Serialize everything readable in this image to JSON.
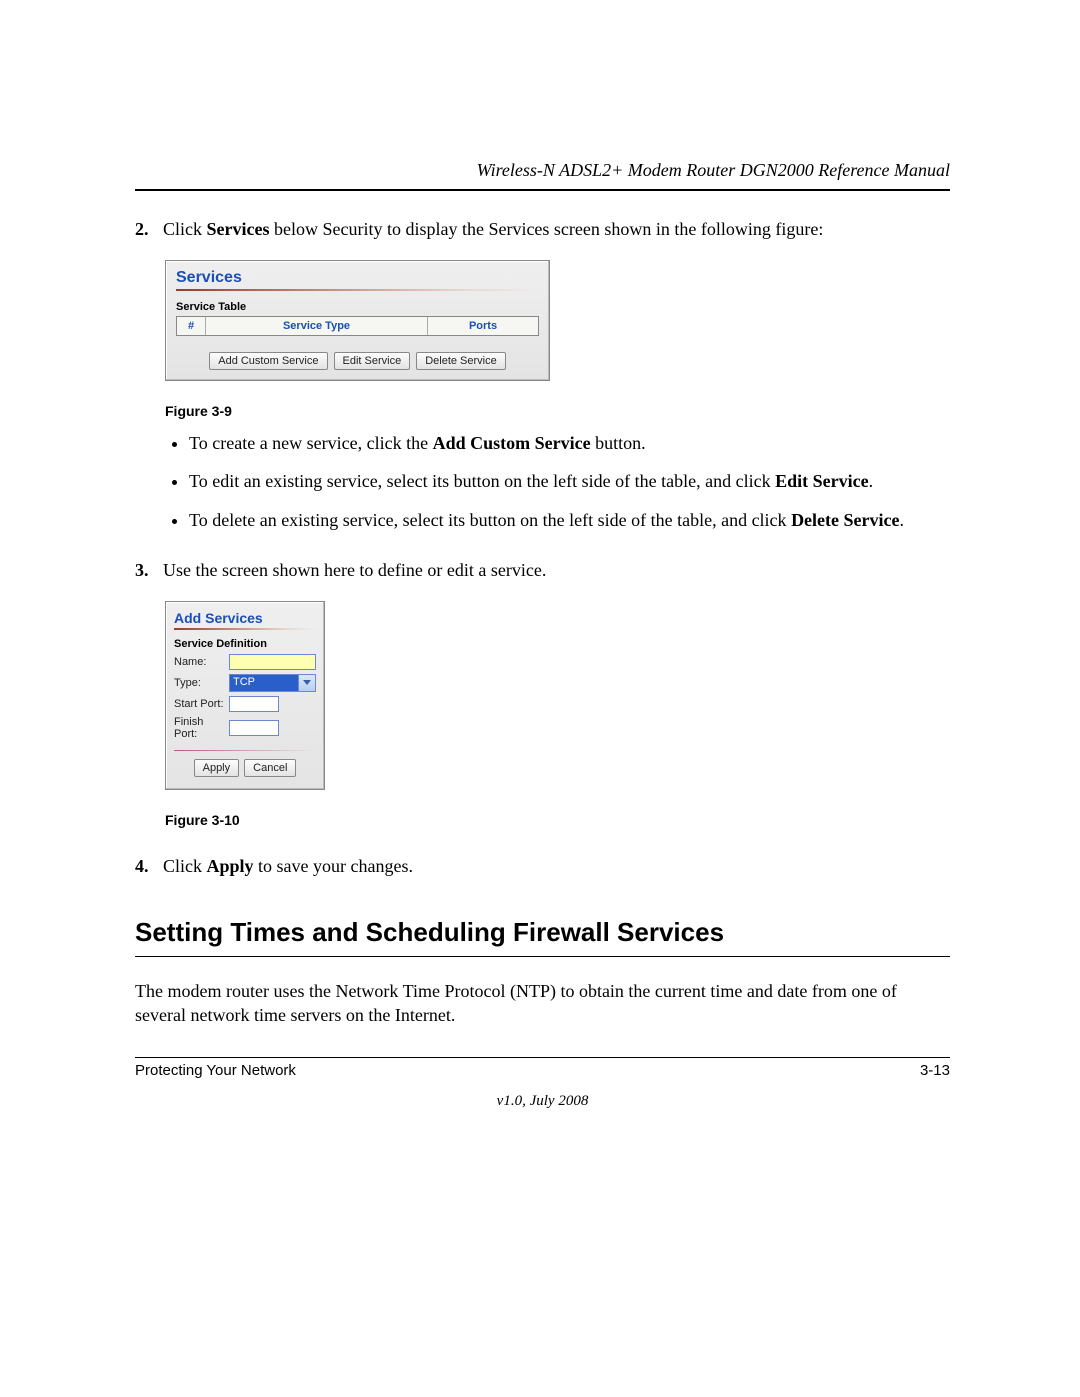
{
  "header": {
    "manual_title": "Wireless-N ADSL2+ Modem Router DGN2000 Reference Manual"
  },
  "steps": {
    "s2_num": "2.",
    "s2_a": "Click ",
    "s2_b": "Services",
    "s2_c": " below Security to display the Services screen shown in the following figure:",
    "s3_num": "3.",
    "s3_text": "Use the screen shown here to define or edit a service.",
    "s4_num": "4.",
    "s4_a": "Click ",
    "s4_b": "Apply",
    "s4_c": " to save your changes."
  },
  "fig9": {
    "title": "Services",
    "subtitle": "Service Table",
    "cols": {
      "hash": "#",
      "type": "Service Type",
      "ports": "Ports"
    },
    "buttons": {
      "add": "Add Custom Service",
      "edit": "Edit Service",
      "del": "Delete Service"
    },
    "caption": "Figure 3-9"
  },
  "bullets": {
    "b1_a": "To create a new service, click the ",
    "b1_b": "Add Custom Service",
    "b1_c": " button.",
    "b2_a": "To edit an existing service, select its button on the left side of the table, and click ",
    "b2_b": "Edit Service",
    "b2_c": ".",
    "b3_a": "To delete an existing service, select its button on the left side of the table, and click ",
    "b3_b": "Delete Service",
    "b3_c": "."
  },
  "fig10": {
    "title": "Add Services",
    "subtitle": "Service Definition",
    "labels": {
      "name": "Name:",
      "type": "Type:",
      "start": "Start Port:",
      "finish": "Finish Port:"
    },
    "type_value": "TCP",
    "buttons": {
      "apply": "Apply",
      "cancel": "Cancel"
    },
    "caption": "Figure 3-10"
  },
  "section_heading": "Setting Times and Scheduling Firewall Services",
  "body_para": "The modem router uses the Network Time Protocol (NTP) to obtain the current time and date from one of several network time servers on the Internet.",
  "footer": {
    "chapter": "Protecting Your Network",
    "page": "3-13",
    "version": "v1.0, July 2008"
  }
}
